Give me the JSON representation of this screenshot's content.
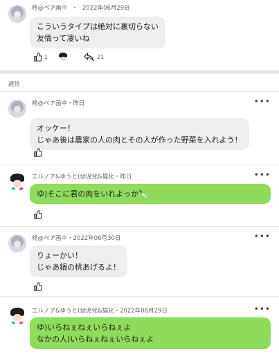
{
  "top_comment": {
    "author": "柊@ペア画中",
    "separator": "・",
    "date": "2022年06月29日",
    "lines": [
      "こういうタイプは絶対に裏切らない",
      "友情って凄いね"
    ],
    "like_count": "1",
    "share_count": "21"
  },
  "replies_label": "返信",
  "replies": [
    {
      "meta": "柊@ペア画中・昨日",
      "lines": [
        "オッケー！",
        "じゃあ後は農家の人の肉とその人が作った野菜を入れよう！"
      ]
    },
    {
      "meta": "エルノア&ゆうと(幼児化&猫化・昨日",
      "lines": [
        "ゆ)そこに君の肉をいれよっか🔪"
      ]
    },
    {
      "meta": "柊@ペア画中・2022年06月30日",
      "lines": [
        "りょーかい！",
        "じゃあ鍋の桃あげるよ！"
      ]
    },
    {
      "meta": "エルノア&ゆうと(幼児化&猫化・2022年06月29日",
      "lines": [
        "ゆ)いらねぇねぇいらねぇよ",
        "なかの人)いらねぇねぇいらねぇよ"
      ]
    }
  ],
  "more_glyph": "•••",
  "colors": {
    "reply_bubble_gray": "#eeeeef",
    "reply_bubble_green": "#8fdc5c",
    "divider_band": "#e8e8ea"
  },
  "icons": {
    "like": "thumbs-up-icon",
    "share": "reply-arrow-icon",
    "more": "more-dots-icon"
  }
}
